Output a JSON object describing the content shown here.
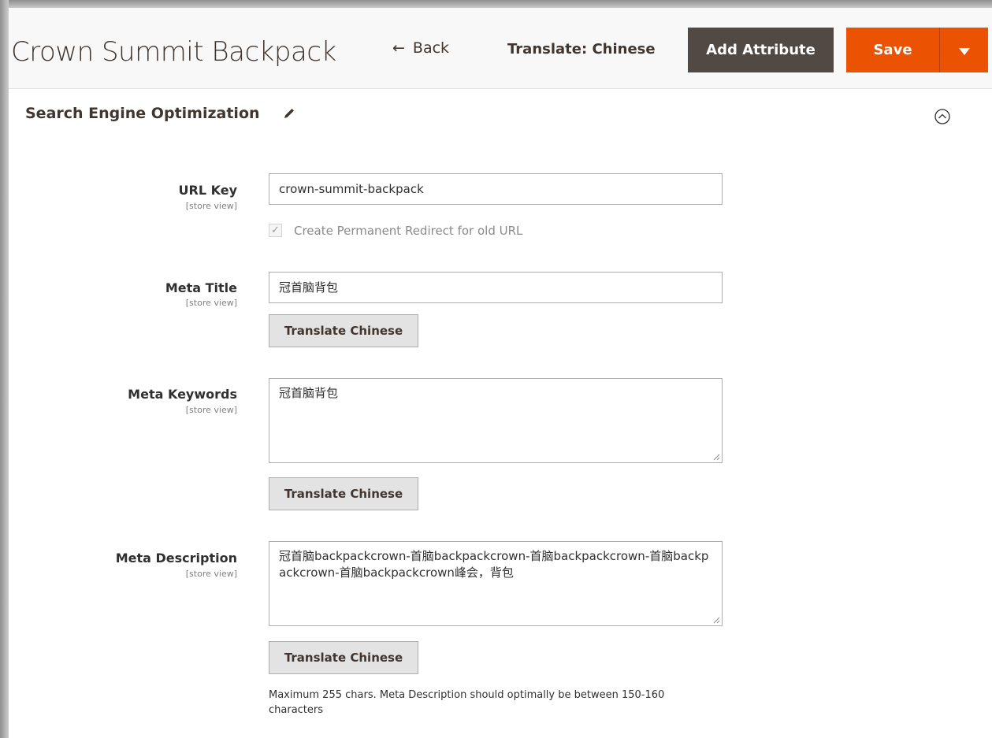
{
  "header": {
    "title": "Crown Summit Backpack",
    "back_label": "Back",
    "back_arrow": "←",
    "translate_label": "Translate: Chinese",
    "add_attribute_label": "Add Attribute",
    "save_label": "Save"
  },
  "section": {
    "title": "Search Engine Optimization"
  },
  "fields": {
    "url_key": {
      "label": "URL Key",
      "scope": "[store view]",
      "value": "crown-summit-backpack",
      "redirect_label": "Create Permanent Redirect for old URL",
      "redirect_checked": true
    },
    "meta_title": {
      "label": "Meta Title",
      "scope": "[store view]",
      "value": "冠首脑背包",
      "button": "Translate Chinese"
    },
    "meta_keywords": {
      "label": "Meta Keywords",
      "scope": "[store view]",
      "value": "冠首脑背包",
      "button": "Translate Chinese"
    },
    "meta_description": {
      "label": "Meta Description",
      "scope": "[store view]",
      "value": "冠首脑backpackcrown-首脑backpackcrown-首脑backpackcrown-首脑backpackcrown-首脑backpackcrown峰会，背包",
      "button": "Translate Chinese",
      "note": "Maximum 255 chars. Meta Description should optimally be between 150-160 characters"
    }
  },
  "colors": {
    "save_orange": "#eb5202",
    "dark_button": "#514943",
    "header_bg": "#f8f8f8"
  }
}
